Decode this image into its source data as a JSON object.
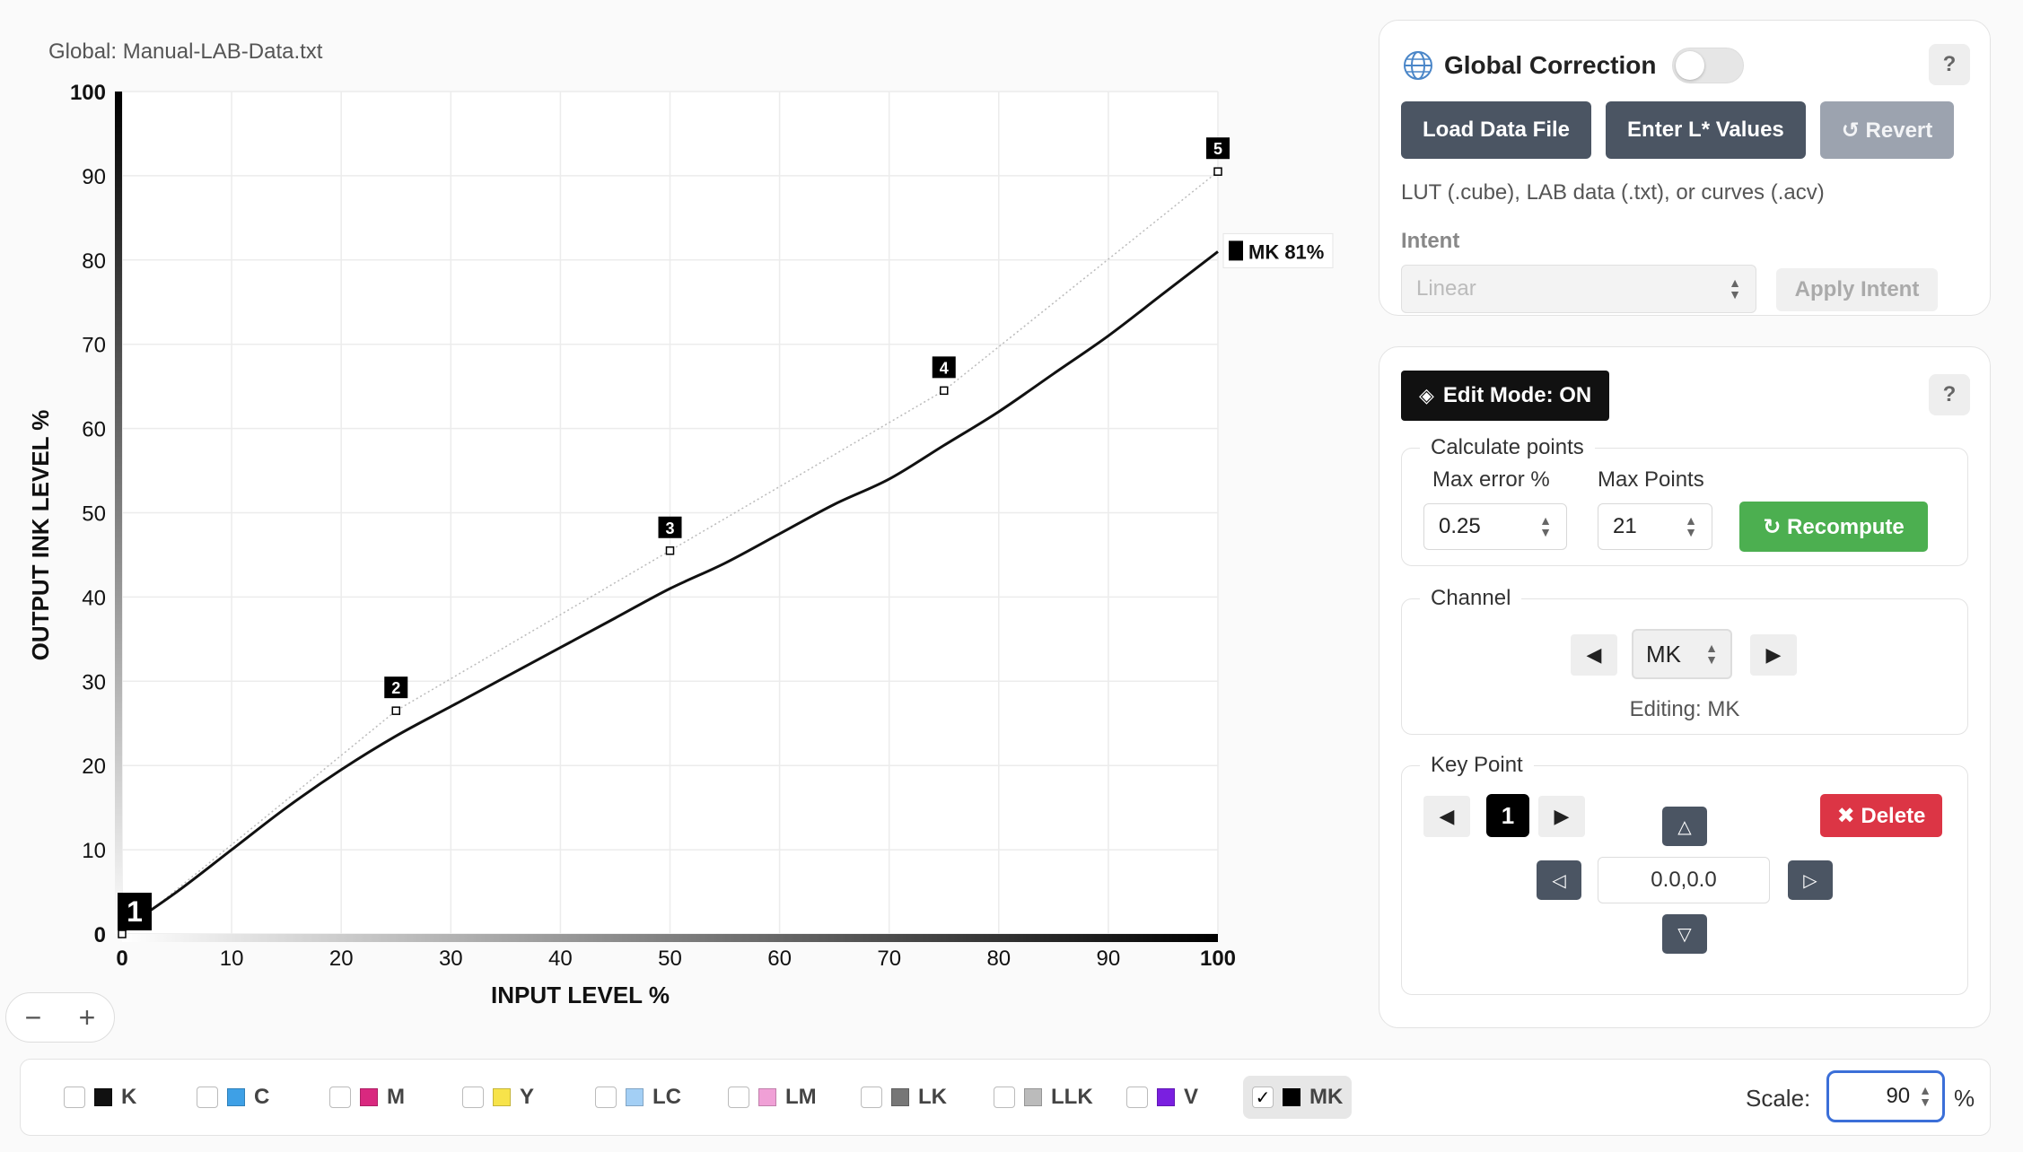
{
  "global_file": "Global: Manual-LAB-Data.txt",
  "chart_data": {
    "type": "line",
    "xlabel": "INPUT LEVEL %",
    "ylabel": "OUTPUT INK LEVEL %",
    "xlim": [
      0,
      100
    ],
    "ylim": [
      0,
      100
    ],
    "x_ticks": [
      0,
      10,
      20,
      30,
      40,
      50,
      60,
      70,
      80,
      90,
      100
    ],
    "y_ticks": [
      0,
      10,
      20,
      30,
      40,
      50,
      60,
      70,
      80,
      90,
      100
    ],
    "grid": true,
    "series": [
      {
        "name": "MK",
        "x": [
          0,
          5,
          10,
          15,
          20,
          25,
          30,
          35,
          40,
          45,
          50,
          55,
          60,
          65,
          70,
          75,
          80,
          85,
          90,
          95,
          100
        ],
        "y": [
          0.5,
          5,
          10,
          15,
          19.5,
          23.5,
          27,
          30.5,
          34,
          37.5,
          41,
          44,
          47.5,
          51,
          54,
          58,
          62,
          66.5,
          71,
          76,
          81
        ]
      }
    ],
    "key_points": [
      {
        "label": "1",
        "x": 0,
        "y": 0
      },
      {
        "label": "2",
        "x": 25,
        "y": 26.5
      },
      {
        "label": "3",
        "x": 50,
        "y": 45.5
      },
      {
        "label": "4",
        "x": 75,
        "y": 64.5
      },
      {
        "label": "5",
        "x": 100,
        "y": 90.5
      }
    ],
    "end_label": "MK 81%"
  },
  "zoom": {
    "minus": "−",
    "plus": "+"
  },
  "global_correction": {
    "title": "Global Correction",
    "help": "?",
    "load_btn": "Load Data File",
    "enter_btn": "Enter L* Values",
    "revert_btn": "↺ Revert",
    "hint": "LUT (.cube), LAB data (.txt), or curves (.acv)",
    "intent_label": "Intent",
    "intent_value": "Linear",
    "apply_btn": "Apply Intent"
  },
  "edit_panel": {
    "edit_mode": "Edit Mode: ON",
    "help": "?",
    "calc_legend": "Calculate points",
    "max_error_label": "Max error %",
    "max_error_value": "0.25",
    "max_points_label": "Max Points",
    "max_points_value": "21",
    "recompute_btn": "↻ Recompute",
    "channel_legend": "Channel",
    "channel_value": "MK",
    "editing_label": "Editing: MK",
    "key_legend": "Key Point",
    "key_point_num": "1",
    "delete_btn": "✖ Delete",
    "coord_value": "0.0,0.0"
  },
  "channels": [
    {
      "name": "K",
      "color": "#111111",
      "checked": false
    },
    {
      "name": "C",
      "color": "#3ea0e6",
      "checked": false
    },
    {
      "name": "M",
      "color": "#d9287f",
      "checked": false
    },
    {
      "name": "Y",
      "color": "#f7e34a",
      "checked": false
    },
    {
      "name": "LC",
      "color": "#a3cff5",
      "checked": false
    },
    {
      "name": "LM",
      "color": "#f0a0d6",
      "checked": false
    },
    {
      "name": "LK",
      "color": "#777777",
      "checked": false
    },
    {
      "name": "LLK",
      "color": "#bbbbbb",
      "checked": false
    },
    {
      "name": "V",
      "color": "#7a1fe0",
      "checked": false
    },
    {
      "name": "MK",
      "color": "#000000",
      "checked": true
    }
  ],
  "scale": {
    "label": "Scale:",
    "value": "90",
    "unit": "%"
  },
  "colors": {
    "accent": "#3b6fd8",
    "recompute": "#4caf50",
    "delete": "#dc3545",
    "button_dark": "#4b5563"
  }
}
